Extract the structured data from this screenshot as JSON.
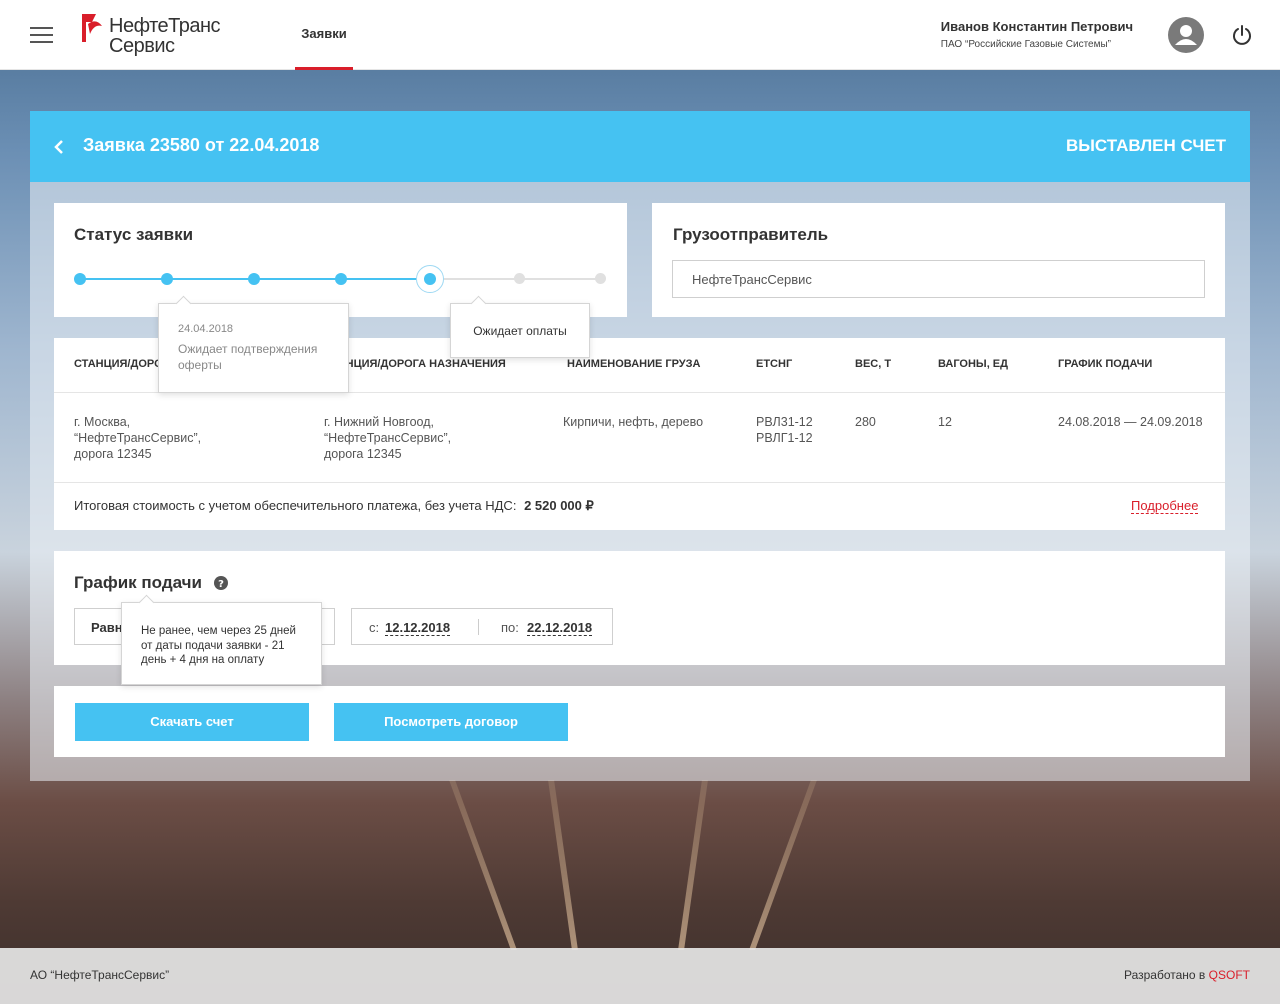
{
  "header": {
    "logo_line1": "НефтеТранс",
    "logo_line2": "Сервис",
    "nav_tab": "Заявки",
    "user_name": "Иванов Константин Петрович",
    "user_org": "ПАО “Российские Газовые Системы”"
  },
  "panel": {
    "title": "Заявка 23580 от 22.04.2018",
    "status": "ВЫСТАВЛЕН СЧЕТ"
  },
  "status_card": {
    "title": "Статус заявки",
    "steps_total": 7,
    "steps_done": 5,
    "tooltip_date": "24.04.2018",
    "tooltip_text": "Ожидает подтверждения оферты",
    "current_tooltip": "Ожидает оплаты"
  },
  "shipper_card": {
    "title": "Грузоотправитель",
    "value": "НефтеТрансСервис"
  },
  "table": {
    "headers": [
      "СТАНЦИЯ/ДОРОГА ОТПРАВЛЕНИЯ",
      "СТАНЦИЯ/ДОРОГА НАЗНАЧЕНИЯ",
      "НАИМЕНОВАНИЕ ГРУЗА",
      "ЕТСНГ",
      "ВЕС, Т",
      "ВАГОНЫ, ЕД",
      "ГРАФИК ПОДАЧИ"
    ],
    "row": {
      "from_1": "г. Москва,",
      "from_2": "“НефтеТрансСервис”,",
      "from_3": "дорога 12345",
      "to_1": "г. Нижний Новгоод,",
      "to_2": "“НефтеТрансСервис”,",
      "to_3": "дорога 12345",
      "cargo": "Кирпичи, нефть, дерево",
      "etsng_1": "РВЛ31-12",
      "etsng_2": "РВЛГ1-12",
      "weight": "280",
      "wagons": "12",
      "schedule": "24.08.2018 — 24.09.2018"
    },
    "total_label": "Итоговая стоимость с учетом обеспечительного платежа, без учета НДС:",
    "total_value": "2 520 000 ₽",
    "details_link": "Подробнее"
  },
  "schedule_card": {
    "title": "График подачи",
    "select_value": "Равномерно",
    "tooltip": "Не ранее, чем через 25 дней от даты подачи заявки - 21 день + 4 дня на оплату",
    "from_label": "с:",
    "from_value": "12.12.2018",
    "to_label": "по:",
    "to_value": "22.12.2018"
  },
  "actions": {
    "download": "Скачать счет",
    "view_contract": "Посмотреть договор"
  },
  "footer": {
    "left": "АО “НефтеТрансСервис”",
    "right_prefix": "Разработано в",
    "right_brand": "QSOFT"
  },
  "colors": {
    "accent": "#45c2f2",
    "brand_red": "#d91e2a"
  }
}
